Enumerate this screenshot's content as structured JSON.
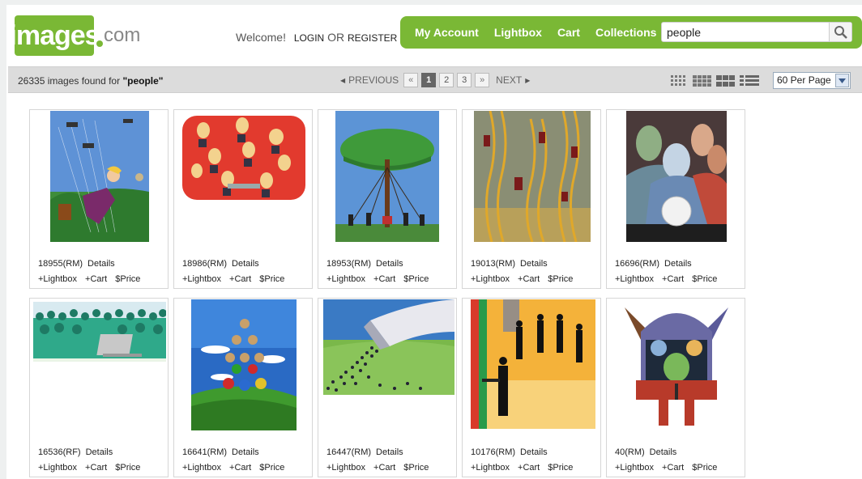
{
  "header": {
    "logo_main": "images",
    "logo_suffix": "com",
    "welcome": "Welcome!",
    "login": "LOGIN",
    "or": "OR",
    "register": "REGISTER"
  },
  "nav": {
    "items": [
      "My Account",
      "Lightbox",
      "Cart",
      "Collections"
    ]
  },
  "search": {
    "value": "people",
    "icon": "search-icon"
  },
  "results": {
    "count_text": "26335 images found for",
    "query": "\"people\""
  },
  "pager": {
    "previous": "PREVIOUS",
    "first": "«",
    "pages": [
      "1",
      "2",
      "3"
    ],
    "last": "»",
    "next": "NEXT",
    "current": "1"
  },
  "views": [
    "small-grid-view-icon",
    "medium-grid-view-icon",
    "large-grid-view-icon",
    "list-view-icon"
  ],
  "per_page": {
    "selected": "60 Per Page"
  },
  "card_labels": {
    "details": "Details",
    "lightbox": "+Lightbox",
    "cart": "+Cart",
    "price": "$Price"
  },
  "images": [
    {
      "id": "18955(RM)",
      "scene": "flying-businesswoman"
    },
    {
      "id": "18986(RM)",
      "scene": "red-board-figures"
    },
    {
      "id": "18953(RM)",
      "scene": "umbrella-tree"
    },
    {
      "id": "19013(RM)",
      "scene": "ladder-climbers"
    },
    {
      "id": "16696(RM)",
      "scene": "crystal-ball-faces"
    },
    {
      "id": "16536(RF)",
      "scene": "crowd-laptop"
    },
    {
      "id": "16641(RM)",
      "scene": "people-tower-balls"
    },
    {
      "id": "16447(RM)",
      "scene": "cornucopia-crowd"
    },
    {
      "id": "10176(RM)",
      "scene": "silhouettes-orange"
    },
    {
      "id": "40(RM)",
      "scene": "plug-head-figure"
    }
  ],
  "colors": {
    "brand_green": "#7ab835",
    "bar_gray": "#dcdcdc"
  }
}
